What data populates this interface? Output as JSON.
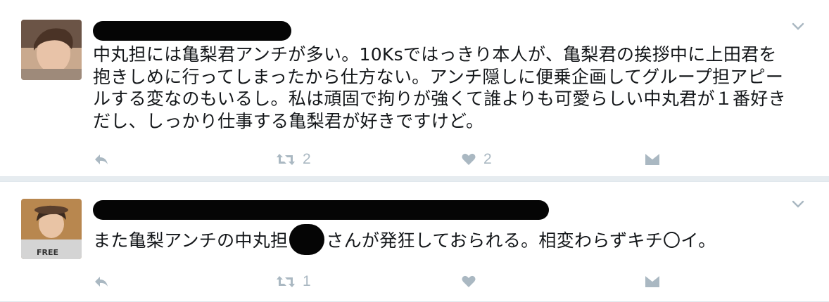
{
  "colors": {
    "background": "#e6ecf0",
    "card": "#ffffff",
    "text": "#14171a",
    "icon_gray": "#aab8c2",
    "redaction": "#050505"
  },
  "tweets": [
    {
      "text": "中丸担には亀梨君アンチが多い。10Ksではっきり本人が、亀梨君の挨拶中に上田君を抱きしめに行ってしまったから仕方ない。アンチ隠しに便乗企画してグループ担アピールする変なのもいるし。私は頑固で拘りが強くて誰よりも可愛らしい中丸君が１番好きだし、しっかり仕事する亀梨君が好きですけど。",
      "retweet_count": "2",
      "like_count": "2",
      "icons": [
        "reply-icon",
        "retweet-icon",
        "heart-icon",
        "mail-icon",
        "chevron-down-icon"
      ]
    },
    {
      "text_before": "また亀梨アンチの中丸担",
      "text_after": "さんが発狂しておられる。相変わらずキチ〇イ。",
      "retweet_count": "1",
      "like_count": "",
      "icons": [
        "reply-icon",
        "retweet-icon",
        "heart-icon",
        "mail-icon",
        "chevron-down-icon"
      ]
    }
  ]
}
